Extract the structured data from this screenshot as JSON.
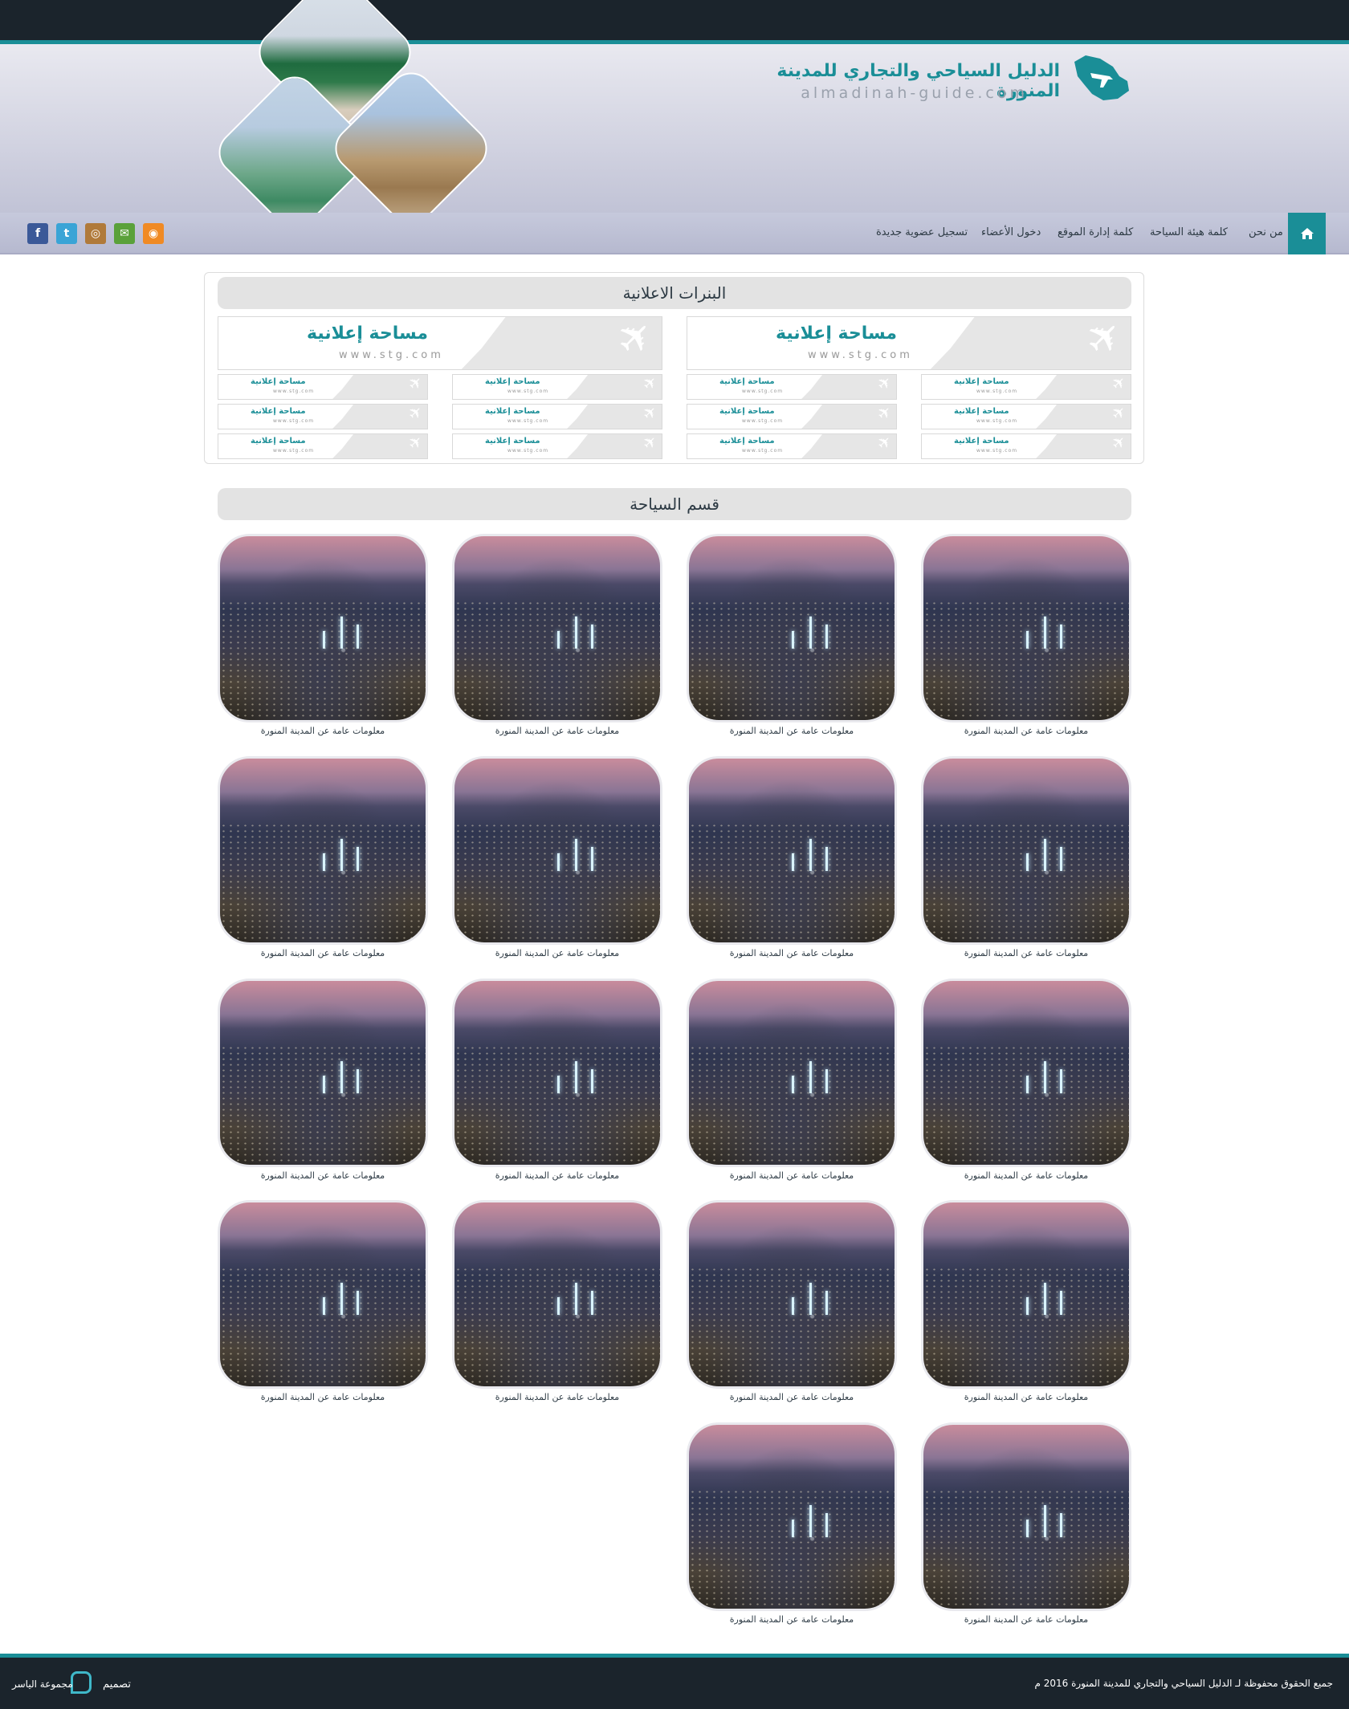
{
  "site": {
    "title": "الدليل السياحي والتجاري للمدينة المنورة",
    "subtitle": "almadinah-guide.com"
  },
  "nav": {
    "home_icon": "home-icon",
    "items": [
      "من نحن",
      "كلمة هيئة السياحة",
      "كلمة إدارة الموقع",
      "دخول الأعضاء",
      "تسجيل عضوية جديدة"
    ]
  },
  "social": [
    {
      "icon": "facebook-icon",
      "glyph": "f",
      "color": "#3b5998"
    },
    {
      "icon": "twitter-icon",
      "glyph": "t",
      "color": "#3aa4d6"
    },
    {
      "icon": "instagram-icon",
      "glyph": "◎",
      "color": "#b07a3a"
    },
    {
      "icon": "email-icon",
      "glyph": "✉",
      "color": "#5aa13a"
    },
    {
      "icon": "rss-icon",
      "glyph": "◉",
      "color": "#f08a24"
    }
  ],
  "ads": {
    "title": "البنرات الاعلانية",
    "ad_text": "مساحة إعلانية",
    "ad_url": "www.stg.com"
  },
  "tourism": {
    "title": "قسم السياحة",
    "item_caption": "معلومات عامة عن المدينة المنورة"
  },
  "footer": {
    "copyright": "جميع الحقوق محفوظة لـ الدليل السياحي والتجاري للمدينة المنورة 2016 م",
    "design_label": "تصميم",
    "designer": "مجموعة الياسر"
  },
  "colors": {
    "accent": "#1a8e97",
    "dark": "#1b242c"
  }
}
